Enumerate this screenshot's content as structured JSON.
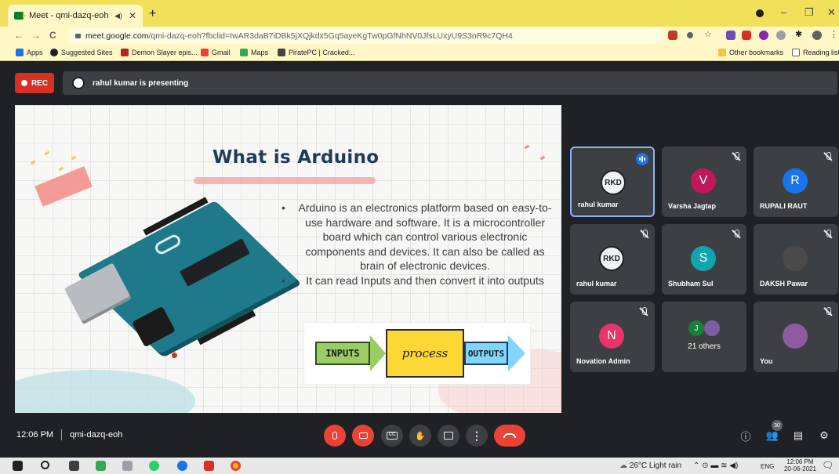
{
  "browser": {
    "tab_title": "Meet - qmi-dazq-eoh",
    "new_tab": "+",
    "tab_close": "✕",
    "url_host": "meet.google.com",
    "url_path": "/qmi-dazq-eoh?fbclid=IwAR3daB7iDBk5jXQjkdx5Gq5ayeKgTw0pGfNhNV0JfsLUxyU9S3nR9c7QH4",
    "nav": {
      "back": "←",
      "forward": "→",
      "reload": "C"
    },
    "bookmarks": [
      "Apps",
      "Suggested Sites",
      "Demon Slayer epis...",
      "Gmail",
      "Maps",
      "PiratePC | Cracked..."
    ],
    "bookmarks_right": [
      "Other bookmarks",
      "Reading list"
    ]
  },
  "meet": {
    "rec_label": "REC",
    "presenting_text": "rahul kumar is presenting",
    "time": "12:06 PM",
    "meeting_code": "qmi-dazq-eoh",
    "participant_badge": "30"
  },
  "slide": {
    "title": "What is Arduino",
    "bullets": [
      "Arduino is an electronics platform based on easy-to-use hardware and software. It is a microcontroller board which can control various electronic components and devices. It can also be called as brain of electronic devices.",
      "It can read Inputs and then convert it into outputs"
    ],
    "diagram": {
      "inputs": "INPUTS",
      "process": "process",
      "outputs": "OUTPUTS"
    }
  },
  "participants": [
    {
      "name": "rahul kumar",
      "avatar": "RKD",
      "color": "#f1f3f4"
    },
    {
      "name": "Varsha Jagtap",
      "avatar": "V",
      "color": "#c2185b"
    },
    {
      "name": "RUPALI RAUT",
      "avatar": "R",
      "color": "#1a73e8"
    },
    {
      "name": "rahul kumar",
      "avatar": "RKD",
      "color": "#f1f3f4"
    },
    {
      "name": "Shubham Sul",
      "avatar": "S",
      "color": "#12a4af"
    },
    {
      "name": "DAKSH Pawar",
      "avatar": "",
      "color": "#4a4a4a"
    },
    {
      "name": "Novation Admin",
      "avatar": "N",
      "color": "#e8336d"
    },
    {
      "name": "21 others",
      "avatar": "J",
      "color": "#188038"
    },
    {
      "name": "You",
      "avatar": "",
      "color": "#8e5aa0"
    }
  ],
  "taskbar": {
    "weather": "26°C  Light rain",
    "lang": "ENG",
    "clock_time": "12:06 PM",
    "clock_date": "20-06-2021"
  }
}
